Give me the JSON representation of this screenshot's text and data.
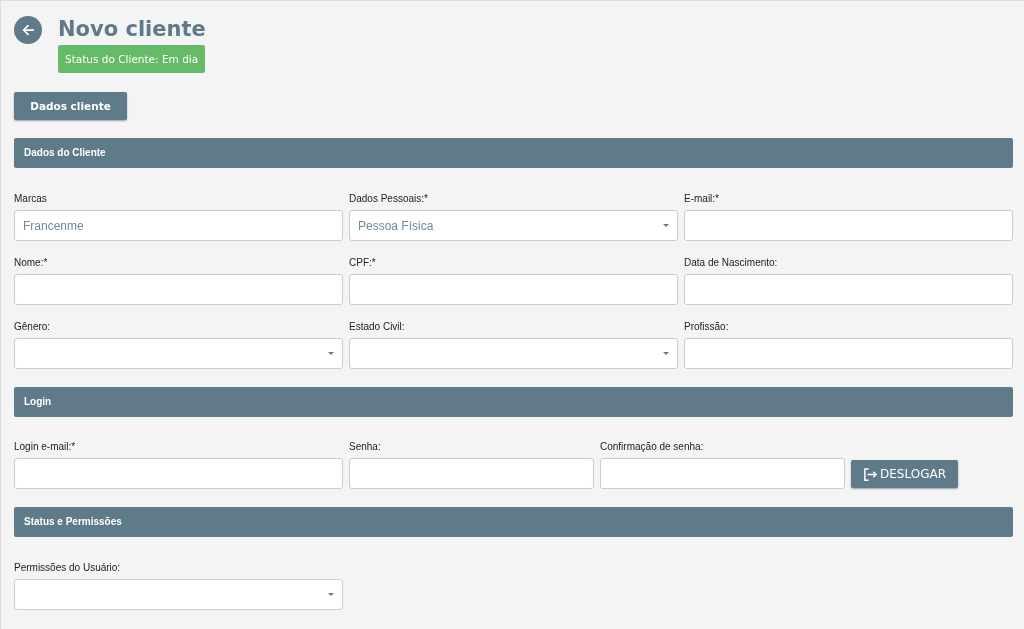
{
  "header": {
    "title": "Novo cliente",
    "status_badge": "Status do Cliente: Em dia"
  },
  "tab_button": "Dados cliente",
  "sections": [
    {
      "title": "Dados do Cliente",
      "kind": "grid",
      "fields": [
        {
          "label": "Marcas",
          "kind": "text",
          "value": "Francenme"
        },
        {
          "label": "Dados Pessoais:*",
          "kind": "select",
          "value": "Pessoa Física"
        },
        {
          "label": "E-mail:*",
          "kind": "text"
        },
        {
          "label": "Nome:*",
          "kind": "text"
        },
        {
          "label": "CPF:*",
          "kind": "text"
        },
        {
          "label": "Data de Nascimento:",
          "kind": "text"
        },
        {
          "label": "Gênero:",
          "kind": "select"
        },
        {
          "label": "Estado Civil:",
          "kind": "select"
        },
        {
          "label": "Profissão:",
          "kind": "text"
        }
      ]
    },
    {
      "title": "Login",
      "kind": "login",
      "fields": [
        {
          "label": "Login e-mail:*",
          "kind": "text"
        },
        {
          "label": "Senha:",
          "kind": "text"
        },
        {
          "label": "Confirmação de senha:",
          "kind": "text"
        }
      ],
      "action": "DESLOGAR"
    },
    {
      "title": "Status e Permissões",
      "kind": "grid",
      "fields": [
        {
          "label": "Permissões do Usuário:",
          "kind": "select"
        }
      ]
    }
  ]
}
